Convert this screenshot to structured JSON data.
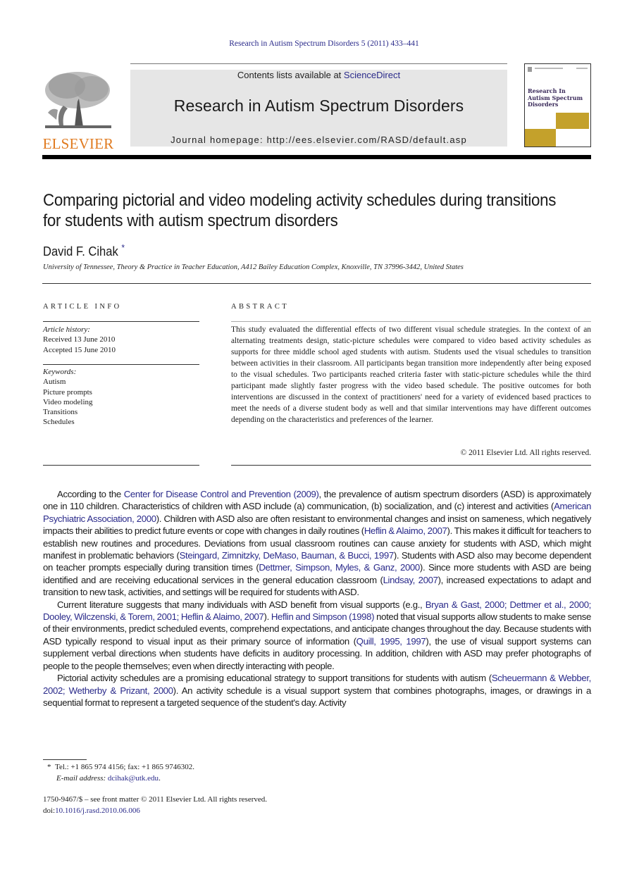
{
  "running_head": "Research in Autism Spectrum Disorders 5 (2011) 433–441",
  "header": {
    "publisher_logo_text": "ELSEVIER",
    "contents_prefix": "Contents lists available at ",
    "contents_link": "ScienceDirect",
    "journal_title": "Research in Autism Spectrum Disorders",
    "homepage": "Journal homepage: http://ees.elsevier.com/RASD/default.asp",
    "cover_title": "Research In Autism Spectrum Disorders",
    "colors": {
      "publisher_orange": "#e07a1f",
      "link_blue": "#2a2a8a",
      "cover_gold": "#c4a12b",
      "header_grey": "#e6e6e6"
    }
  },
  "article": {
    "title": "Comparing pictorial and video modeling activity schedules during transitions for students with autism spectrum disorders",
    "author": "David F. Cihak",
    "author_mark": "*",
    "affiliation": "University of Tennessee, Theory & Practice in Teacher Education, A412 Bailey Education Complex, Knoxville, TN 37996-3442, United States"
  },
  "article_info": {
    "heading": "ARTICLE INFO",
    "history_label": "Article history:",
    "received": "Received 13 June 2010",
    "accepted": "Accepted 15 June 2010",
    "keywords_label": "Keywords:",
    "keywords": [
      "Autism",
      "Picture prompts",
      "Video modeling",
      "Transitions",
      "Schedules"
    ]
  },
  "abstract": {
    "heading": "ABSTRACT",
    "text": "This study evaluated the differential effects of two different visual schedule strategies. In the context of an alternating treatments design, static-picture schedules were compared to video based activity schedules as supports for three middle school aged students with autism. Students used the visual schedules to transition between activities in their classroom. All participants began transition more independently after being exposed to the visual schedules. Two participants reached criteria faster with static-picture schedules while the third participant made slightly faster progress with the video based schedule. The positive outcomes for both interventions are discussed in the context of practitioners' need for a variety of evidenced based practices to meet the needs of a diverse student body as well and that similar interventions may have different outcomes depending on the characteristics and preferences of the learner.",
    "copyright": "© 2011 Elsevier Ltd. All rights reserved."
  },
  "body": {
    "p1": [
      {
        "t": "According to the "
      },
      {
        "t": "Center for Disease Control and Prevention (2009)",
        "link": true
      },
      {
        "t": ", the prevalence of autism spectrum disorders (ASD) is approximately one in 110 children. Characteristics of children with ASD include (a) communication, (b) socialization, and (c) interest and activities ("
      },
      {
        "t": "American Psychiatric Association, 2000",
        "link": true
      },
      {
        "t": "). Children with ASD also are often resistant to environmental changes and insist on sameness, which negatively impacts their abilities to predict future events or cope with changes in daily routines ("
      },
      {
        "t": "Heflin & Alaimo, 2007",
        "link": true
      },
      {
        "t": "). This makes it difficult for teachers to establish new routines and procedures. Deviations from usual classroom routines can cause anxiety for students with ASD, which might manifest in problematic behaviors ("
      },
      {
        "t": "Steingard, Zimnitzky, DeMaso, Bauman, & Bucci, 1997",
        "link": true
      },
      {
        "t": "). Students with ASD also may become dependent on teacher prompts especially during transition times ("
      },
      {
        "t": "Dettmer, Simpson, Myles, & Ganz, 2000",
        "link": true
      },
      {
        "t": "). Since more students with ASD are being identified and are receiving educational services in the general education classroom ("
      },
      {
        "t": "Lindsay, 2007",
        "link": true
      },
      {
        "t": "), increased expectations to adapt and transition to new task, activities, and settings will be required for students with ASD."
      }
    ],
    "p2": [
      {
        "t": "Current literature suggests that many individuals with ASD benefit from visual supports (e.g., "
      },
      {
        "t": "Bryan & Gast, 2000; Dettmer et al., 2000; Dooley, Wilczenski, & Torem, 2001; Heflin & Alaimo, 2007",
        "link": true
      },
      {
        "t": "). "
      },
      {
        "t": "Heflin and Simpson (1998)",
        "link": true
      },
      {
        "t": " noted that visual supports allow students to make sense of their environments, predict scheduled events, comprehend expectations, and anticipate changes throughout the day. Because students with ASD typically respond to visual input as their primary source of information ("
      },
      {
        "t": "Quill, 1995, 1997",
        "link": true
      },
      {
        "t": "), the use of visual support systems can supplement verbal directions when students have deficits in auditory processing. In addition, children with ASD may prefer photographs of people to the people themselves; even when directly interacting with people."
      }
    ],
    "p3": [
      {
        "t": "Pictorial activity schedules are a promising educational strategy to support transitions for students with autism ("
      },
      {
        "t": "Scheuermann & Webber, 2002; Wetherby & Prizant, 2000",
        "link": true
      },
      {
        "t": "). An activity schedule is a visual support system that combines photographs, images, or drawings in a sequential format to represent a targeted sequence of the student's day. Activity"
      }
    ]
  },
  "footnote": {
    "mark": "*",
    "contact": "Tel.: +1 865 974 4156; fax: +1 865 9746302.",
    "email_label": "E-mail address:",
    "email": "dcihak@utk.edu"
  },
  "front_matter": {
    "issn_line": "1750-9467/$ – see front matter © 2011 Elsevier Ltd. All rights reserved.",
    "doi_prefix": "doi:",
    "doi": "10.1016/j.rasd.2010.06.006"
  }
}
